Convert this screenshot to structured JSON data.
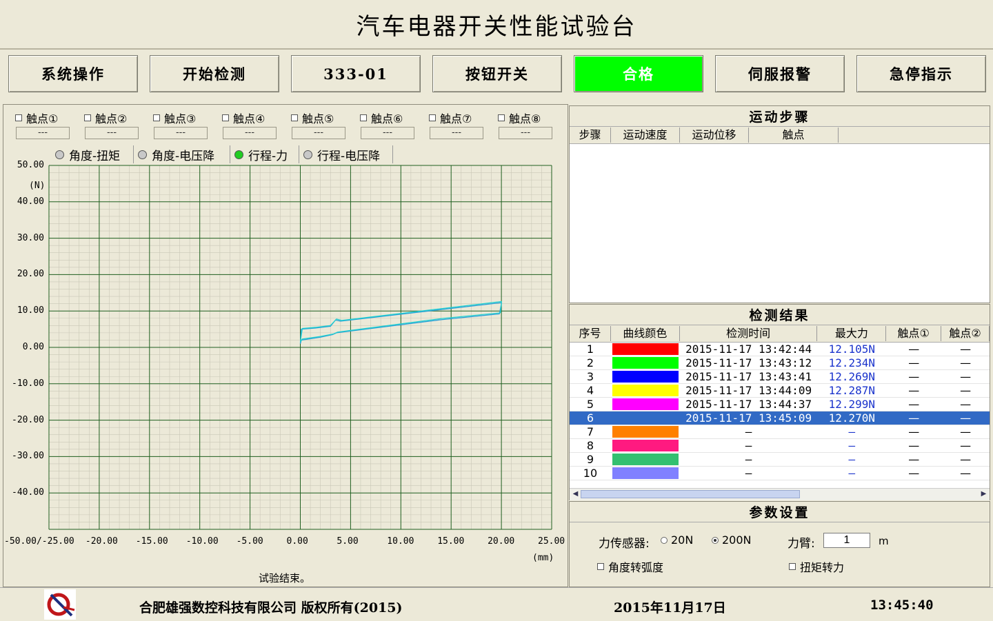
{
  "window_title": "汽车电器开关性能试验台",
  "toolbar": [
    {
      "label": "系统操作",
      "name": "system-ops-button",
      "type": "normal"
    },
    {
      "label": "开始检测",
      "name": "start-test-button",
      "type": "normal"
    },
    {
      "label": "333-01",
      "name": "product-code-display",
      "type": "normal"
    },
    {
      "label": "按钮开关",
      "name": "switch-type-button",
      "type": "normal"
    },
    {
      "label": "合格",
      "name": "pass-indicator",
      "type": "pass",
      "color": "#00ff00"
    },
    {
      "label": "伺服报警",
      "name": "servo-alarm-button",
      "type": "normal"
    },
    {
      "label": "急停指示",
      "name": "estop-indicator",
      "type": "normal"
    }
  ],
  "contacts": [
    {
      "label": "触点①",
      "value": "---"
    },
    {
      "label": "触点②",
      "value": "---"
    },
    {
      "label": "触点③",
      "value": "---"
    },
    {
      "label": "触点④",
      "value": "---"
    },
    {
      "label": "触点⑤",
      "value": "---"
    },
    {
      "label": "触点⑥",
      "value": "---"
    },
    {
      "label": "触点⑦",
      "value": "---"
    },
    {
      "label": "触点⑧",
      "value": "---"
    }
  ],
  "chart_tabs": [
    {
      "label": "角度-扭矩",
      "selected": false
    },
    {
      "label": "角度-电压降",
      "selected": false
    },
    {
      "label": "行程-力",
      "selected": true
    },
    {
      "label": "行程-电压降",
      "selected": false
    }
  ],
  "chart_data": {
    "type": "line",
    "ylabel": "(N)",
    "xlabel": "(mm)",
    "xlim": [
      -25,
      25
    ],
    "ylim": [
      -50,
      50
    ],
    "x_ticks": [
      "-50.00/-25.00",
      "-20.00",
      "-15.00",
      "-10.00",
      "-5.00",
      "0.00",
      "5.00",
      "10.00",
      "15.00",
      "20.00",
      "25.00"
    ],
    "y_ticks": [
      "50.00",
      "40.00",
      "30.00",
      "20.00",
      "10.00",
      "0.00",
      "-10.00",
      "-20.00",
      "-30.00",
      "-40.00"
    ],
    "grid": true,
    "grid_color": "#1f5f1f",
    "series": [
      {
        "color": "#2a9fd6",
        "x": [
          0,
          0.1,
          1.5,
          3,
          3.5,
          4,
          20,
          20,
          19.8,
          14,
          3.6,
          3.2,
          2,
          0.1,
          0
        ],
        "y": [
          1,
          5,
          5.3,
          5.8,
          7.5,
          7.2,
          12.3,
          12,
          9.2,
          7.6,
          4,
          3.5,
          2.8,
          2,
          1
        ]
      },
      {
        "color": "#20d0d0",
        "x": [
          0,
          0.2,
          1.5,
          3,
          3.6,
          4.1,
          20,
          20,
          19.9,
          14,
          3.7,
          3.3,
          2,
          0.2,
          0
        ],
        "y": [
          1.5,
          5.2,
          5.5,
          6,
          7.8,
          7.4,
          12.6,
          12.2,
          9.5,
          7.9,
          4.2,
          3.7,
          3,
          2.3,
          1.5
        ]
      }
    ]
  },
  "status_text": "试验结束。",
  "motion_steps": {
    "title": "运动步骤",
    "columns": [
      "步骤",
      "运动速度",
      "运动位移",
      "触点"
    ]
  },
  "results": {
    "title": "检测结果",
    "columns": [
      "序号",
      "曲线颜色",
      "检测时间",
      "最大力",
      "触点①",
      "触点②"
    ],
    "rows": [
      {
        "no": "1",
        "color": "#ff0000",
        "time": "2015-11-17  13:42:44",
        "force": "12.105N",
        "c1": "—",
        "c2": "—"
      },
      {
        "no": "2",
        "color": "#00ff00",
        "time": "2015-11-17  13:43:12",
        "force": "12.234N",
        "c1": "—",
        "c2": "—"
      },
      {
        "no": "3",
        "color": "#0000ff",
        "time": "2015-11-17  13:43:41",
        "force": "12.269N",
        "c1": "—",
        "c2": "—"
      },
      {
        "no": "4",
        "color": "#ffff00",
        "time": "2015-11-17  13:44:09",
        "force": "12.287N",
        "c1": "—",
        "c2": "—"
      },
      {
        "no": "5",
        "color": "#ff00ff",
        "time": "2015-11-17  13:44:37",
        "force": "12.299N",
        "c1": "—",
        "c2": "—"
      },
      {
        "no": "6",
        "color": "#316ac5",
        "time": "2015-11-17  13:45:09",
        "force": "12.270N",
        "c1": "—",
        "c2": "—",
        "selected": true
      },
      {
        "no": "7",
        "color": "#ff8000",
        "time": "—",
        "force": "—",
        "c1": "—",
        "c2": "—"
      },
      {
        "no": "8",
        "color": "#ff1a80",
        "time": "—",
        "force": "—",
        "c1": "—",
        "c2": "—"
      },
      {
        "no": "9",
        "color": "#33c070",
        "time": "—",
        "force": "—",
        "c1": "—",
        "c2": "—"
      },
      {
        "no": "10",
        "color": "#8080ff",
        "time": "—",
        "force": "—",
        "c1": "—",
        "c2": "—"
      }
    ]
  },
  "params": {
    "title": "参数设置",
    "sensor_label": "力传感器:",
    "sensor_opt1": "20N",
    "sensor_opt2": "200N",
    "arm_label": "力臂:",
    "arm_value": "1",
    "arm_unit": "m",
    "angle_rad_label": "角度转弧度",
    "torque_force_label": "扭矩转力"
  },
  "footer": {
    "company": "合肥雄强数控科技有限公司  版权所有(2015)",
    "date": "2015年11月17日",
    "time": "13:45:40"
  }
}
